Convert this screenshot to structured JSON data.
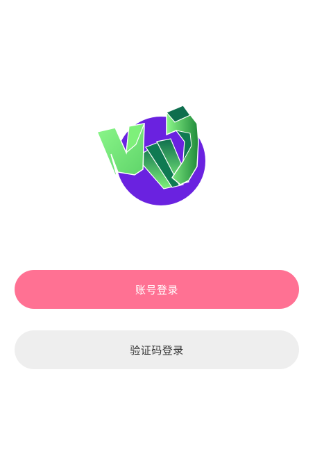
{
  "logo": {
    "icon": "kc-logo-icon",
    "circle_color": "#6a22e0",
    "light_green": "#7ef07a",
    "dark_green": "#0f7a52"
  },
  "buttons": {
    "account_login": {
      "label": "账号登录",
      "bg_color": "#ff7193",
      "text_color": "#ffffff"
    },
    "code_login": {
      "label": "验证码登录",
      "bg_color": "#eeeeee",
      "text_color": "#333333"
    }
  }
}
